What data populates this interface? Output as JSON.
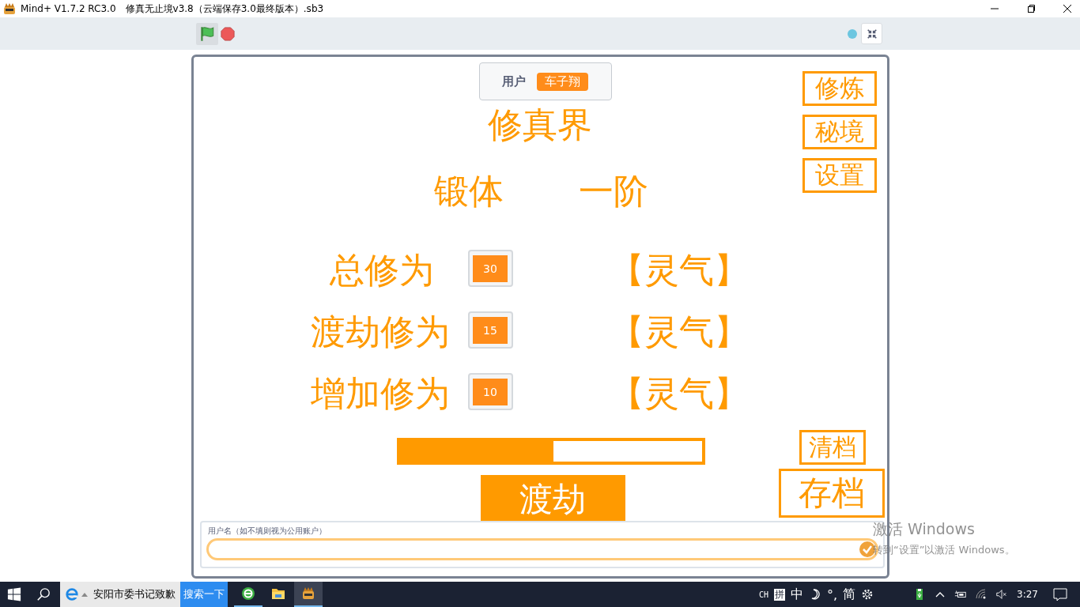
{
  "window": {
    "title": "Mind+ V1.7.2 RC3.0　修真无止境v3.8（云端保存3.0最终版本）.sb3"
  },
  "stage": {
    "user_monitor": {
      "label": "用户",
      "value": "车子翔"
    },
    "realm_title": "修真界",
    "realm": "锻体",
    "realm_level": "一阶",
    "side_buttons": [
      "修炼",
      "秘境",
      "设置"
    ],
    "stats": [
      {
        "label": "总修为",
        "value": "30",
        "unit": "【灵气】"
      },
      {
        "label": "渡劫修为",
        "value": "15",
        "unit": "【灵气】"
      },
      {
        "label": "增加修为",
        "value": "10",
        "unit": "【灵气】"
      }
    ],
    "progress": {
      "level": 0.51
    },
    "clear_button": "清档",
    "save_button": "存档",
    "tribulation_button": "渡劫",
    "ask": {
      "prompt": "用户名（如不填则视为公用账户）"
    }
  },
  "activation": {
    "title": "激活 Windows",
    "text": "转到“设置”以激活 Windows。"
  },
  "taskbar": {
    "news": "安阳市委书记致歉",
    "search_button": "搜索一下",
    "apps": [
      {
        "kind": "browser",
        "running": true,
        "selected": false
      },
      {
        "kind": "folder",
        "running": false,
        "selected": false
      },
      {
        "kind": "mindplus",
        "running": true,
        "selected": true
      }
    ],
    "tray": {
      "language": "CH",
      "ime_mode": "拼",
      "ime_lang": "中",
      "punct": "°,",
      "charset": "简",
      "time": "3:27"
    }
  }
}
